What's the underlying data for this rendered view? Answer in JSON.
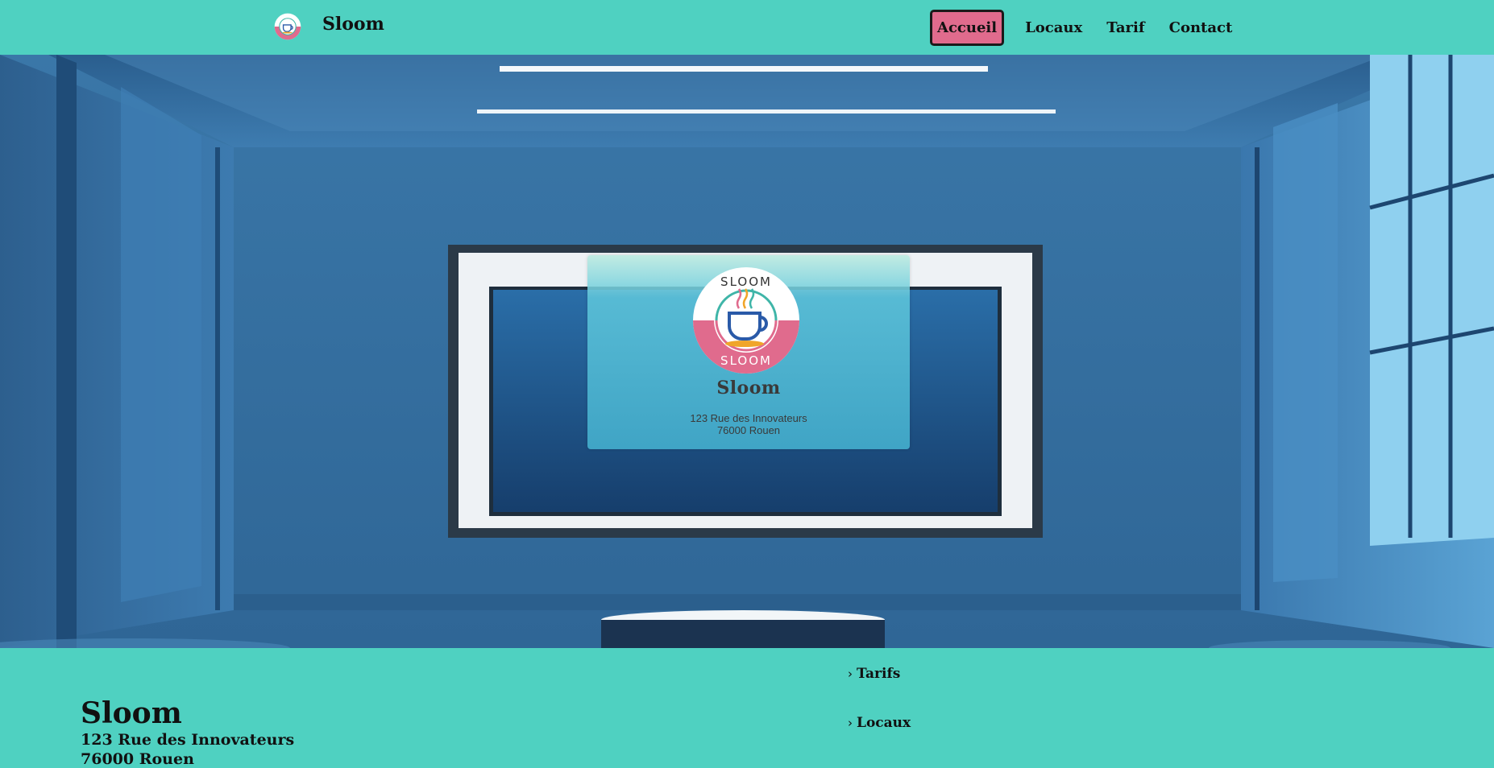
{
  "brand": {
    "name": "Sloom",
    "logo_icon": "coffee-cup-logo-icon",
    "logo_text": "SLOOM",
    "colors": {
      "primary": "#4fd1c1",
      "accent": "#e06b8d",
      "text": "#111111"
    }
  },
  "nav": {
    "items": [
      {
        "label": "Accueil",
        "active": true
      },
      {
        "label": "Locaux",
        "active": false
      },
      {
        "label": "Tarif",
        "active": false
      },
      {
        "label": "Contact",
        "active": false
      }
    ]
  },
  "hero": {
    "card": {
      "title": "Sloom",
      "address_line1": "123 Rue des Innovateurs",
      "address_line2": "76000 Rouen"
    }
  },
  "footer": {
    "name": "Sloom",
    "address_line1": "123 Rue des Innovateurs",
    "address_line2": "76000 Rouen",
    "links": [
      {
        "label": "Tarifs",
        "icon": "chevron-right-icon"
      },
      {
        "label": "Locaux",
        "icon": "chevron-right-icon"
      }
    ]
  }
}
